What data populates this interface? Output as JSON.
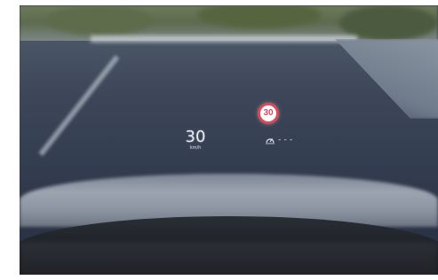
{
  "hud": {
    "speed": {
      "value": "30",
      "unit": "km/h"
    },
    "speed_limit_sign": {
      "value": "30",
      "ring_color": "#d94a5a"
    },
    "cruise_control": {
      "icon": "cruise-control-icon",
      "set_speed": "---"
    }
  },
  "colors": {
    "hud_text": "#e8ecf3",
    "road": "#3c4658",
    "dashboard": "#1d2026"
  }
}
